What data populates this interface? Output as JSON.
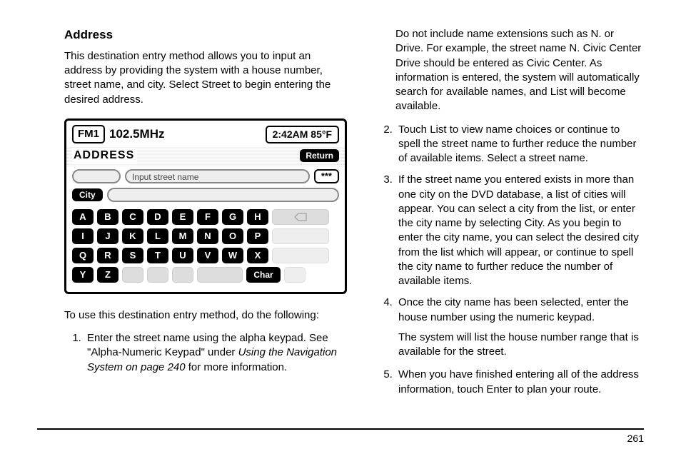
{
  "heading": "Address",
  "intro": "This destination entry method allows you to input an address by providing the system with a house number, street name, and city. Select Street to begin entering the desired address.",
  "lead_out": "To use this destination entry method, do the following:",
  "device": {
    "band": "FM1",
    "freq": "102.5MHz",
    "time_temp": "2:42AM 85°F",
    "title": "ADDRESS",
    "return_label": "Return",
    "street_placeholder": "Input street name",
    "stars_label": "***",
    "city_label": "City",
    "char_label": "Char",
    "keys_row1": [
      "A",
      "B",
      "C",
      "D",
      "E",
      "F",
      "G",
      "H"
    ],
    "keys_row2": [
      "I",
      "J",
      "K",
      "L",
      "M",
      "N",
      "O",
      "P"
    ],
    "keys_row3": [
      "Q",
      "R",
      "S",
      "T",
      "U",
      "V",
      "W",
      "X"
    ],
    "keys_row4": [
      "Y",
      "Z"
    ]
  },
  "steps_left": [
    {
      "text": "Enter the street name using the alpha keypad. See \"Alpha-Numeric Keypad\" under ",
      "ref": "Using the Navigation System on page 240",
      "after": " for more information."
    }
  ],
  "right_top": "Do not include name extensions such as N. or Drive. For example, the street name N. Civic Center Drive should be entered as Civic Center. As information is entered, the system will automatically search for available names, and List will become available.",
  "steps_right": [
    "Touch List to view name choices or continue to spell the street name to further reduce the number of available items. Select a street name.",
    "If the street name you entered exists in more than one city on the DVD database, a list of cities will appear. You can select a city from the list, or enter the city name by selecting City. As you begin to enter the city name, you can select the desired city from the list which will appear, or continue to spell the city name to further reduce the number of available items.",
    "Once the city name has been selected, enter the house number using the numeric keypad.",
    "When you have finished entering all of the address information, touch Enter to plan your route."
  ],
  "step4_sub": "The system will list the house number range that is available for the street.",
  "page_number": "261"
}
